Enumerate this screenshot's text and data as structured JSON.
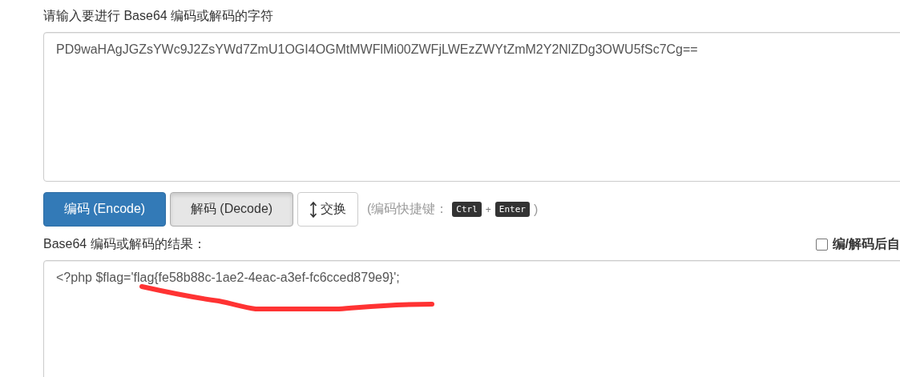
{
  "input_label": "请输入要进行 Base64 编码或解码的字符",
  "input_value": "PD9waHAgJGZsYWc9J2ZsYWd7ZmU1OGI4OGMtMWFlMi00ZWFjLWEzZWYtZmM2Y2NlZDg3OWU5fSc7Cg==",
  "buttons": [
    {
      "label": "编码 (Encode)",
      "kind": "primary"
    },
    {
      "label": "解码 (Decode)",
      "kind": "pressed"
    },
    {
      "label": "交换",
      "kind": "swap"
    }
  ],
  "shortcut_hint": {
    "prefix": "(编码快捷键：",
    "keys": [
      "Ctrl",
      "Enter"
    ],
    "plus": "+",
    "suffix": ")"
  },
  "result_label": "Base64 编码或解码的结果：",
  "auto_option": {
    "label": "编/解码后自",
    "checked": false
  },
  "result_value": "<?php $flag='flag{fe58b88c-1ae2-4eac-a3ef-fc6cced879e9}';"
}
